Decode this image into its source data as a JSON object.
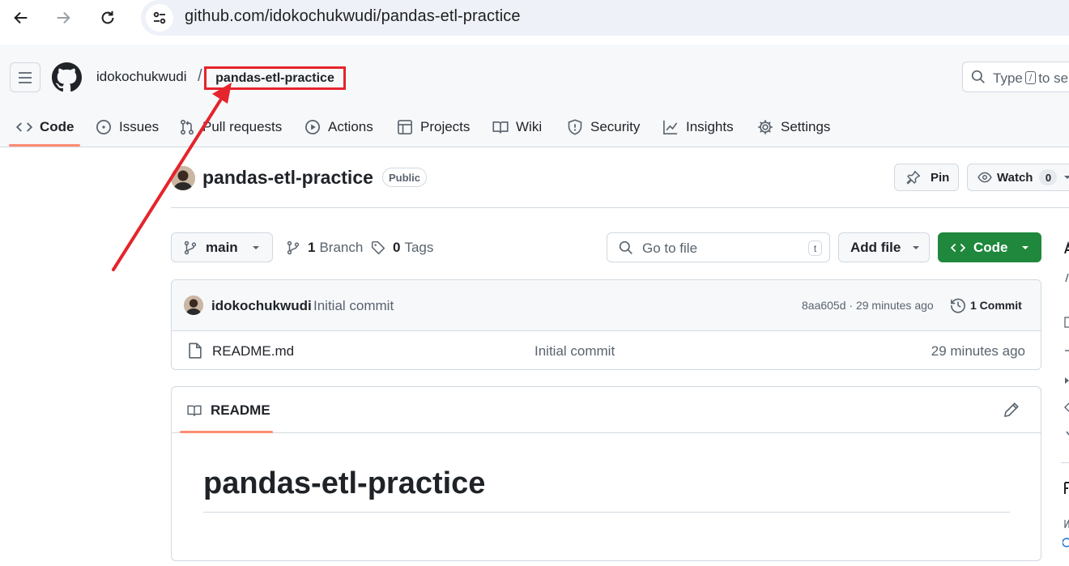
{
  "browser": {
    "url": "github.com/idokochukwudi/pandas-etl-practice",
    "back_icon": "arrow-left-icon",
    "forward_icon": "arrow-right-icon",
    "reload_icon": "reload-icon"
  },
  "header": {
    "owner": "idokochukwudi",
    "separator": "/",
    "repo": "pandas-etl-practice",
    "search_prefix": "Type",
    "search_key": "/",
    "search_suffix": "to se"
  },
  "tabs": [
    {
      "label": "Code",
      "icon": "code-icon",
      "active": true
    },
    {
      "label": "Issues",
      "icon": "issue-opened-icon"
    },
    {
      "label": "Pull requests",
      "icon": "git-pull-request-icon"
    },
    {
      "label": "Actions",
      "icon": "play-icon"
    },
    {
      "label": "Projects",
      "icon": "table-icon"
    },
    {
      "label": "Wiki",
      "icon": "book-icon"
    },
    {
      "label": "Security",
      "icon": "shield-icon"
    },
    {
      "label": "Insights",
      "icon": "graph-icon"
    },
    {
      "label": "Settings",
      "icon": "gear-icon"
    }
  ],
  "repo": {
    "title": "pandas-etl-practice",
    "visibility": "Public",
    "pin_label": "Pin",
    "watch_label": "Watch",
    "watch_count": "0"
  },
  "branch_bar": {
    "branch": "main",
    "branch_count": "1",
    "branch_label": "Branch",
    "tag_count": "0",
    "tag_label": "Tags",
    "goto_placeholder": "Go to file",
    "goto_key": "t",
    "add_file_label": "Add file",
    "code_label": "Code"
  },
  "latest_commit": {
    "author": "idokochukwudi",
    "message": "Initial commit",
    "meta": "8aa605d · 29 minutes ago",
    "count_label": "1 Commit"
  },
  "files": [
    {
      "name": "README.md",
      "message": "Initial commit",
      "age": "29 minutes ago"
    }
  ],
  "readme": {
    "tab_label": "README",
    "heading": "pandas-etl-practice"
  },
  "colors": {
    "accent_underline": "#fd8c73",
    "primary_button": "#1f883d",
    "annotation_red": "#e5242b",
    "border": "#d1d9e0"
  }
}
